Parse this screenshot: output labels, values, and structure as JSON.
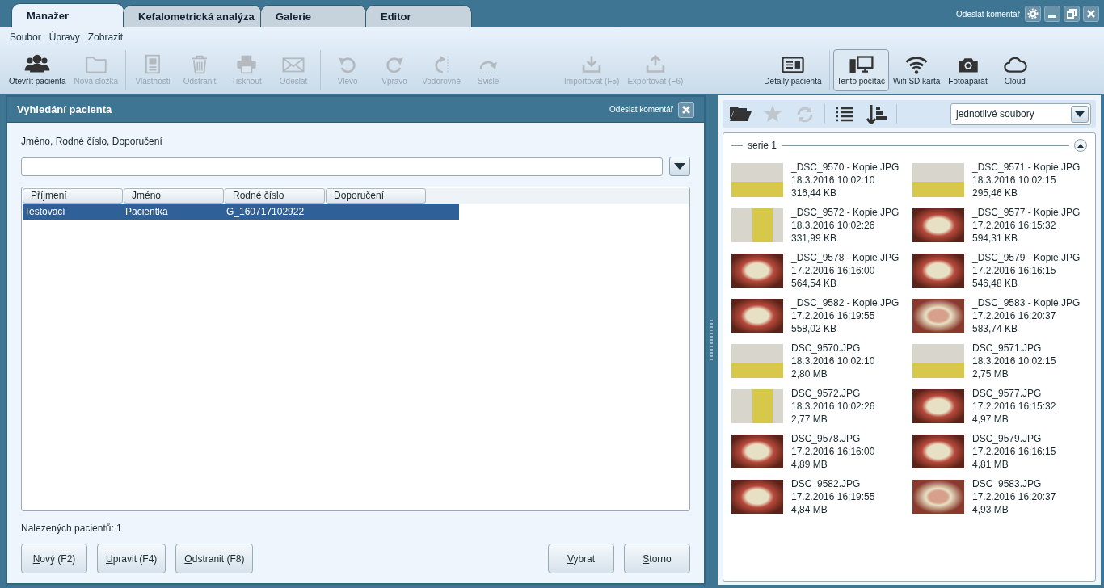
{
  "tabs": [
    {
      "label": "Manažer",
      "selected": true
    },
    {
      "label": "Kefalometrická analýza",
      "selected": false
    },
    {
      "label": "Galerie",
      "selected": false
    },
    {
      "label": "Editor",
      "selected": false
    }
  ],
  "title_bar": {
    "feedback_link": "Odeslat komentář"
  },
  "menu": [
    "Soubor",
    "Úpravy",
    "Zobrazit"
  ],
  "toolbar": [
    {
      "groups": [
        [
          {
            "label": "Otevřít pacienta",
            "kind": "people",
            "disabled": false
          },
          {
            "label": "Nová složka",
            "kind": "folder",
            "disabled": true
          }
        ],
        [
          {
            "label": "Vlastnosti",
            "kind": "card",
            "disabled": true
          },
          {
            "label": "Odstranit",
            "kind": "trash",
            "disabled": true
          },
          {
            "label": "Tisknout",
            "kind": "printer",
            "disabled": true
          },
          {
            "label": "Odeslat",
            "kind": "mail",
            "disabled": true
          }
        ],
        [
          {
            "label": "Vlevo",
            "kind": "rotate-left",
            "disabled": true
          },
          {
            "label": "Vpravo",
            "kind": "rotate-right",
            "disabled": true
          },
          {
            "label": "Vodorovně",
            "kind": "flip-h",
            "disabled": true
          },
          {
            "label": "Svisle",
            "kind": "flip-v",
            "disabled": true
          }
        ],
        [
          {
            "label": "Importovat (F5)",
            "kind": "import",
            "disabled": true
          },
          {
            "label": "Exportovat (F6)",
            "kind": "export",
            "disabled": true
          }
        ],
        [
          {
            "label": "Detaily pacienta",
            "kind": "details",
            "disabled": false
          }
        ]
      ]
    },
    {
      "groups": [
        [
          {
            "label": "Tento počítač",
            "kind": "computer",
            "disabled": false,
            "selected": true
          },
          {
            "label": "Wifi SD karta",
            "kind": "wifi",
            "disabled": false,
            "selected": false
          },
          {
            "label": "Fotoaparát",
            "kind": "camera",
            "disabled": false,
            "selected": false
          },
          {
            "label": "Cloud",
            "kind": "cloud",
            "disabled": false,
            "selected": false
          }
        ]
      ]
    }
  ],
  "dialog": {
    "title": "Vyhledání pacienta",
    "feedback_link": "Odeslat komentář",
    "search_label": "Jméno, Rodné číslo, Doporučení",
    "table": {
      "columns": [
        "Příjmení",
        "Jméno",
        "Rodné číslo",
        "Doporučení"
      ],
      "rows": [
        {
          "cells": [
            "Testovací",
            "Pacientka",
            "G_160717102922",
            ""
          ],
          "selected": true
        }
      ]
    },
    "found_count": "Nalezených pacientů: 1",
    "buttons_left": [
      {
        "label": "Nový (F2)",
        "mnemonic": true
      },
      {
        "label": "Upravit (F4)",
        "mnemonic": true
      },
      {
        "label": "Odstranit (F8)",
        "mnemonic": true
      }
    ],
    "buttons_right": [
      {
        "label": "Vybrat",
        "mnemonic": true
      },
      {
        "label": "Storno",
        "mnemonic": true
      }
    ]
  },
  "browser": {
    "view_select": "jednotlivé soubory",
    "series": {
      "label": "serie 1",
      "expanded": true,
      "files": [
        {
          "name": "_DSC_9570 - Kopie.JPG",
          "date": "18.3.2016 10:02:10",
          "size": "316,44 KB",
          "kind": "portrait"
        },
        {
          "name": "_DSC_9571 - Kopie.JPG",
          "date": "18.3.2016 10:02:15",
          "size": "295,46 KB",
          "kind": "portrait"
        },
        {
          "name": "_DSC_9572 - Kopie.JPG",
          "date": "18.3.2016 10:02:26",
          "size": "331,99 KB",
          "kind": "lying"
        },
        {
          "name": "_DSC_9577 - Kopie.JPG",
          "date": "17.2.2016 16:15:32",
          "size": "594,31 KB",
          "kind": "teeth"
        },
        {
          "name": "_DSC_9578 - Kopie.JPG",
          "date": "17.2.2016 16:16:00",
          "size": "564,54 KB",
          "kind": "teeth"
        },
        {
          "name": "_DSC_9579 - Kopie.JPG",
          "date": "17.2.2016 16:16:15",
          "size": "546,48 KB",
          "kind": "teeth"
        },
        {
          "name": "_DSC_9582 - Kopie.JPG",
          "date": "17.2.2016 16:19:55",
          "size": "558,02 KB",
          "kind": "teeth"
        },
        {
          "name": "_DSC_9583 - Kopie.JPG",
          "date": "17.2.2016 16:20:37",
          "size": "583,74 KB",
          "kind": "palate"
        },
        {
          "name": "DSC_9570.JPG",
          "date": "18.3.2016 10:02:10",
          "size": "2,80 MB",
          "kind": "portrait"
        },
        {
          "name": "DSC_9571.JPG",
          "date": "18.3.2016 10:02:15",
          "size": "2,75 MB",
          "kind": "portrait"
        },
        {
          "name": "DSC_9572.JPG",
          "date": "18.3.2016 10:02:26",
          "size": "2,77 MB",
          "kind": "lying"
        },
        {
          "name": "DSC_9577.JPG",
          "date": "17.2.2016 16:15:32",
          "size": "4,97 MB",
          "kind": "teeth"
        },
        {
          "name": "DSC_9578.JPG",
          "date": "17.2.2016 16:16:00",
          "size": "4,89 MB",
          "kind": "teeth"
        },
        {
          "name": "DSC_9579.JPG",
          "date": "17.2.2016 16:16:15",
          "size": "4,81 MB",
          "kind": "teeth"
        },
        {
          "name": "DSC_9582.JPG",
          "date": "17.2.2016 16:19:55",
          "size": "4,84 MB",
          "kind": "teeth"
        },
        {
          "name": "DSC_9583.JPG",
          "date": "17.2.2016 16:20:37",
          "size": "4,93 MB",
          "kind": "palate"
        }
      ]
    }
  }
}
